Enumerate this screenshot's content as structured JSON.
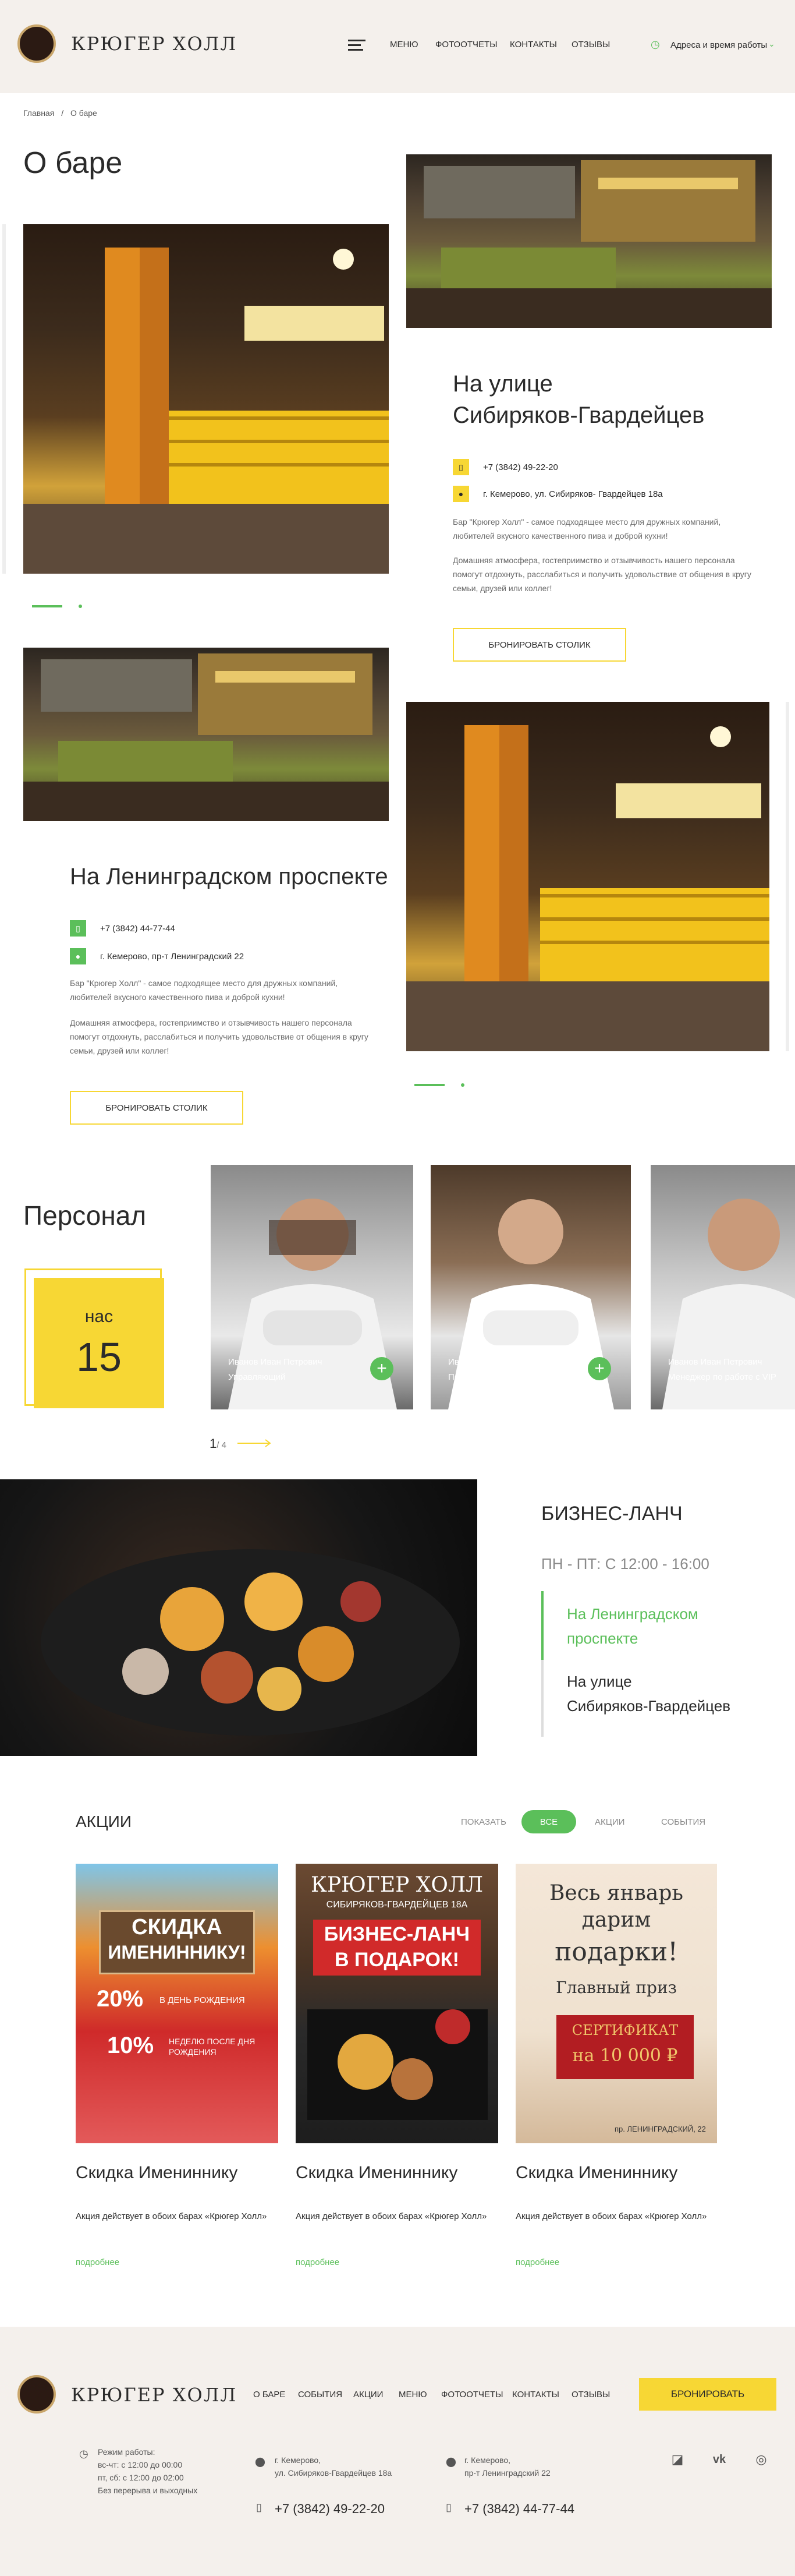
{
  "header": {
    "logo": "КРЮГЕР ХОЛЛ",
    "nav": [
      "МЕНЮ",
      "ФОТООТЧЕТЫ",
      "КОНТАКТЫ",
      "ОТЗЫВЫ"
    ],
    "address_link": "Адреса и время работы"
  },
  "breadcrumb": {
    "home": "Главная",
    "sep": "/",
    "current": "О баре"
  },
  "page": {
    "title": "О баре"
  },
  "venue1": {
    "title_line1": "На улице",
    "title_line2": "Сибиряков-Гвардейцев",
    "phone": "+7 (3842) 49-22-20",
    "address": "г. Кемерово, ул. Сибиряков- Гвардейцев 18а",
    "desc1": "Бар \"Крюгер Холл\" - самое подходящее место для дружных компаний, любителей вкусного качественного пива и доброй кухни!",
    "desc2": "Домашняя атмосфера, гостеприимство и отзывчивость нашего персонала помогут отдохнуть, расслабиться и получить удовольствие от общения в кругу семьи, друзей или коллег!",
    "button": "БРОНИРОВАТЬ СТОЛИК"
  },
  "venue2": {
    "title": "На Ленинградском проспекте",
    "phone": "+7 (3842) 44-77-44",
    "address": "г. Кемерово, пр-т Ленинградский 22",
    "desc1": "Бар \"Крюгер Холл\" - самое подходящее место для дружных компаний, любителей вкусного качественного пива и доброй кухни!",
    "desc2": "Домашняя атмосфера, гостеприимство и отзывчивость нашего персонала помогут отдохнуть, расслабиться и получить удовольствие от общения в кругу семьи, друзей или коллег!",
    "button": "БРОНИРОВАТЬ СТОЛИК"
  },
  "staff": {
    "title": "Персонал",
    "count_label": "нас",
    "count": "15",
    "cards": [
      {
        "name": "Иванов Иван Петрович",
        "role": "Управляющий"
      },
      {
        "name": "Иванов Иван Петрович",
        "role": "Повар"
      },
      {
        "name": "Иванов Иван Петрович",
        "role": "Менеджер по работе с VIP"
      }
    ],
    "pager_current": "1",
    "pager_total": "/ 4"
  },
  "lunch": {
    "title": "БИЗНЕС-ЛАНЧ",
    "time": "ПН - ПТ: С 12:00 - 16:00",
    "loc1_line1": "На Ленинградском",
    "loc1_line2": "проспекте",
    "loc2_line1": "На улице",
    "loc2_line2": "Сибиряков-Гвардейцев"
  },
  "promos": {
    "title": "АКЦИИ",
    "filter_label": "ПОКАЗАТЬ",
    "filters": [
      "ВСЕ",
      "АКЦИИ",
      "СОБЫТИЯ"
    ],
    "items": [
      {
        "title": "Скидка Имениннику",
        "desc": "Акция действует в обоих барах «Крюгер Холл»",
        "more": "подробнее",
        "banner_l1": "СКИДКА",
        "banner_l2": "ИМЕНИННИКУ!",
        "banner_l3": "20%",
        "banner_l3b": "В ДЕНЬ РОЖДЕНИЯ",
        "banner_l4": "10%",
        "banner_l4b": "НЕДЕЛЮ ПОСЛЕ ДНЯ РОЖДЕНИЯ"
      },
      {
        "title": "Скидка Имениннику",
        "desc": "Акция действует в обоих барах «Крюгер Холл»",
        "more": "подробнее",
        "banner_l1": "КРЮГЕР ХОЛЛ",
        "banner_l2": "СИБИРЯКОВ-ГВАРДЕЙЦЕВ 18А",
        "banner_l3": "БИЗНЕС-ЛАНЧ",
        "banner_l4": "В ПОДАРОК!"
      },
      {
        "title": "Скидка Имениннику",
        "desc": "Акция действует в обоих барах «Крюгер Холл»",
        "more": "подробнее",
        "banner_l1": "Весь январь",
        "banner_l2": "дарим",
        "banner_l3": "подарки!",
        "banner_l4": "Главный приз",
        "banner_l5": "СЕРТИФИКАТ",
        "banner_l6": "на 10 000 ₽",
        "banner_l7": "пр. ЛЕНИНГРАДСКИЙ, 22"
      }
    ]
  },
  "footer": {
    "logo": "КРЮГЕР ХОЛЛ",
    "nav": [
      "О БАРЕ",
      "СОБЫТИЯ",
      "АКЦИИ",
      "МЕНЮ",
      "ФОТООТЧЕТЫ",
      "КОНТАКТЫ",
      "ОТЗЫВЫ"
    ],
    "book_button": "БРОНИРОВАТЬ",
    "hours_title": "Режим работы:",
    "hours1": "вс-чт: с 12:00 до 00:00",
    "hours2": "пт, сб: с 12:00 до 02:00",
    "hours3": "Без перерыва и выходных",
    "addr1_l1": "г. Кемерово,",
    "addr1_l2": "ул. Сибиряков-Гвардейцев 18а",
    "addr2_l1": "г. Кемерово,",
    "addr2_l2": "пр-т Ленинградский 22",
    "phone1": "+7 (3842) 49-22-20",
    "phone2": "+7 (3842) 44-77-44"
  }
}
